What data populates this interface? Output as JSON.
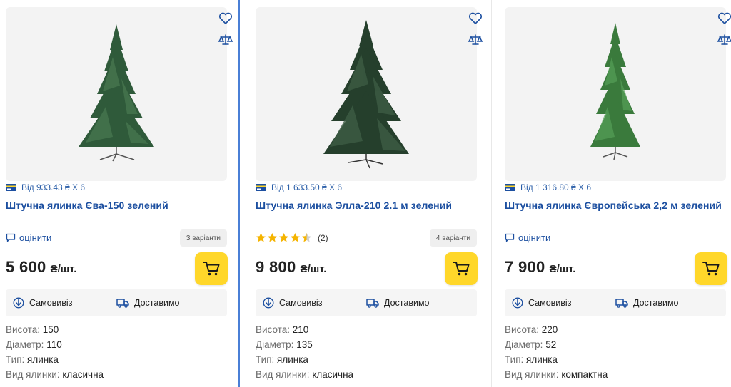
{
  "colors": {
    "link": "#1c4fa0",
    "cart": "#ffd72a",
    "divider_active": "#4a7fd6"
  },
  "products": [
    {
      "credit_text": "Від 933.43 ₴ X 6",
      "title": "Штучна ялинка Єва-150 зелений",
      "rate_label": "оцінити",
      "variants": "3 варіанти",
      "price": "5 600",
      "unit": "₴/шт.",
      "pickup": "Самовивіз",
      "delivery": "Доставимо",
      "specs": [
        {
          "k": "Висота:",
          "v": "150"
        },
        {
          "k": "Діаметр:",
          "v": "110"
        },
        {
          "k": "Тип:",
          "v": "ялинка"
        },
        {
          "k": "Вид ялинки:",
          "v": "класична"
        }
      ]
    },
    {
      "credit_text": "Від 1 633.50 ₴ X 6",
      "title": "Штучна ялинка Элла-210 2.1 м зелений",
      "rating": 4.5,
      "reviews": "(2)",
      "variants": "4 варіанти",
      "price": "9 800",
      "unit": "₴/шт.",
      "pickup": "Самовивіз",
      "delivery": "Доставимо",
      "specs": [
        {
          "k": "Висота:",
          "v": "210"
        },
        {
          "k": "Діаметр:",
          "v": "135"
        },
        {
          "k": "Тип:",
          "v": "ялинка"
        },
        {
          "k": "Вид ялинки:",
          "v": "класична"
        }
      ]
    },
    {
      "credit_text": "Від 1 316.80 ₴ X 6",
      "title": "Штучна ялинка Європейська 2,2 м зелений",
      "rate_label": "оцінити",
      "price": "7 900",
      "unit": "₴/шт.",
      "pickup": "Самовивіз",
      "delivery": "Доставимо",
      "specs": [
        {
          "k": "Висота:",
          "v": "220"
        },
        {
          "k": "Діаметр:",
          "v": "52"
        },
        {
          "k": "Тип:",
          "v": "ялинка"
        },
        {
          "k": "Вид ялинки:",
          "v": "компактна"
        }
      ]
    }
  ]
}
